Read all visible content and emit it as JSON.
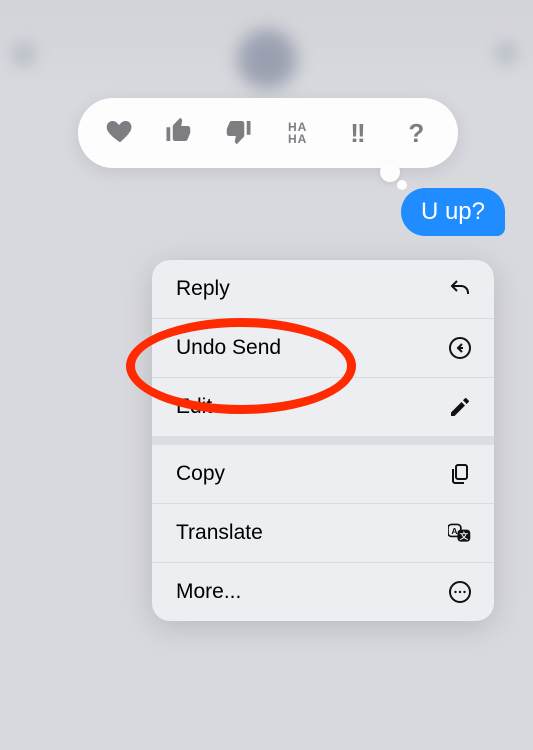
{
  "tapback": {
    "heart": "heart",
    "thumbs_up": "thumbs-up",
    "thumbs_down": "thumbs-down",
    "haha": "HA HA",
    "exclaim": "!!",
    "question": "?"
  },
  "message": {
    "text": "U up?"
  },
  "menu": {
    "reply": "Reply",
    "undo_send": "Undo Send",
    "edit": "Edit",
    "copy": "Copy",
    "translate": "Translate",
    "more": "More..."
  },
  "annotation": {
    "highlight_target": "undo_send",
    "color": "#ff2a00"
  }
}
